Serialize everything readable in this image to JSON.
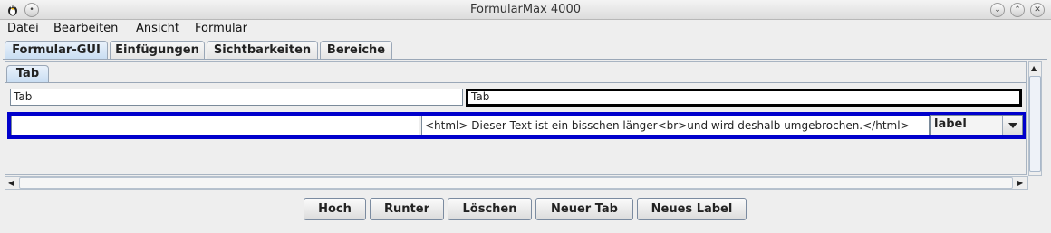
{
  "window": {
    "title": "FormularMax 4000"
  },
  "menu": {
    "items": [
      "Datei",
      "Bearbeiten",
      "Ansicht",
      "Formular"
    ]
  },
  "tabs": [
    {
      "label": "Formular-GUI",
      "active": true
    },
    {
      "label": "Einfügungen",
      "active": false
    },
    {
      "label": "Sichtbarkeiten",
      "active": false
    },
    {
      "label": "Bereiche",
      "active": false
    }
  ],
  "form": {
    "inner_tab": "Tab",
    "row1": {
      "left_value": "Tab",
      "right_value": "Tab"
    },
    "row2": {
      "left_value": "",
      "text_value": "<html> Dieser Text ist ein bisschen länger<br>und wird deshalb umgebrochen.</html>",
      "type_value": "label"
    }
  },
  "buttons": [
    "Hoch",
    "Runter",
    "Löschen",
    "Neuer Tab",
    "Neues Label"
  ]
}
